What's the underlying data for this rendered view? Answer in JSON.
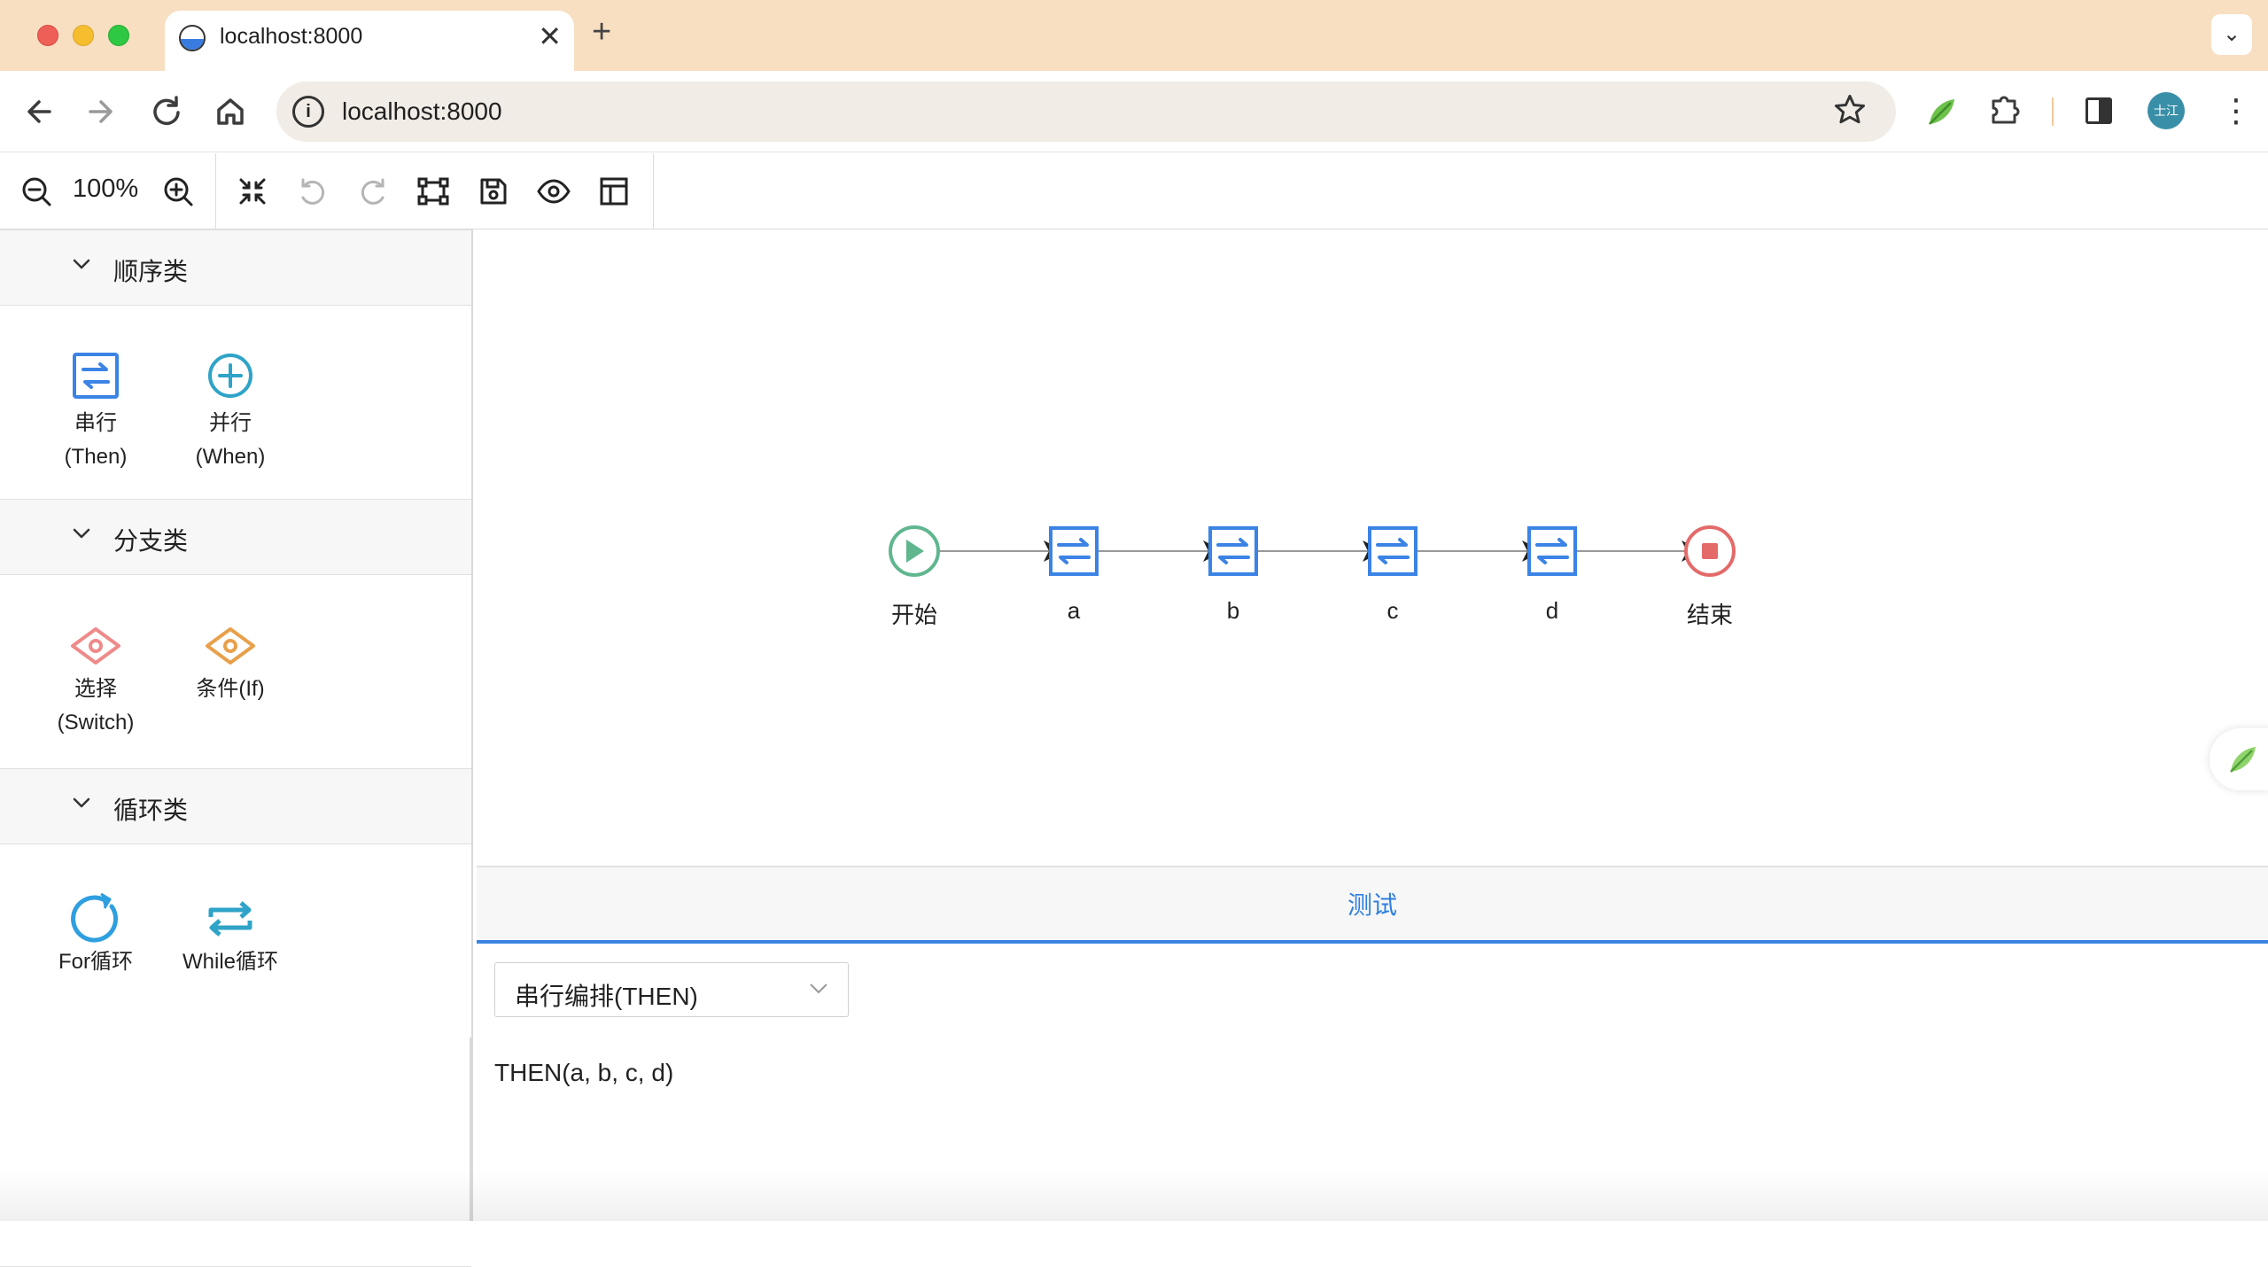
{
  "browser": {
    "tab_title": "localhost:8000",
    "tab_close": "✕",
    "new_tab": "+",
    "tab_menu": "⌄",
    "url": "localhost:8000",
    "avatar_text": "士江",
    "more": "⋮"
  },
  "toolbar": {
    "zoom": "100%"
  },
  "palette": {
    "sections": [
      {
        "title": "顺序类",
        "items": [
          {
            "line1": "串行",
            "line2": "(Then)"
          },
          {
            "line1": "并行",
            "line2": "(When)"
          }
        ]
      },
      {
        "title": "分支类",
        "items": [
          {
            "line1": "选择",
            "line2": "(Switch)"
          },
          {
            "line1": "条件(If)",
            "line2": ""
          }
        ]
      },
      {
        "title": "循环类",
        "items": [
          {
            "line1": "For循环",
            "line2": ""
          },
          {
            "line1": "While循环",
            "line2": ""
          }
        ]
      }
    ]
  },
  "flow": {
    "nodes": [
      "开始",
      "a",
      "b",
      "c",
      "d",
      "结束"
    ]
  },
  "panel": {
    "tab": "测试",
    "select_value": "串行编排(THEN)",
    "expression": "THEN(a, b, c, d)"
  },
  "colors": {
    "accent": "#2f7fe0",
    "start": "#5fb68f",
    "end": "#e46a6a",
    "node": "#3b83e5",
    "branch_red": "#ef8a8a",
    "branch_orange": "#e8a04a",
    "loop": "#2f9fe0"
  }
}
